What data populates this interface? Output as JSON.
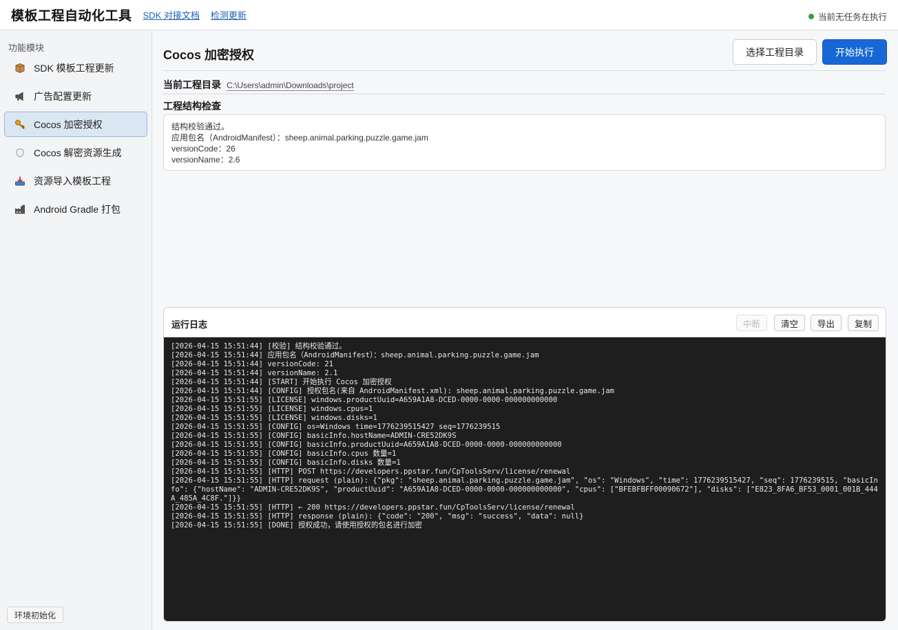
{
  "header": {
    "title": "模板工程自动化工具",
    "links": [
      "SDK 对接文档",
      "检测更新"
    ],
    "status": "当前无任务在执行",
    "status_color": "#2ea043"
  },
  "sidebar": {
    "section_title": "功能模块",
    "items": [
      {
        "label": "SDK 模板工程更新",
        "icon": "box-icon",
        "active": false
      },
      {
        "label": "广告配置更新",
        "icon": "megaphone-icon",
        "active": false
      },
      {
        "label": "Cocos 加密授权",
        "icon": "key-icon",
        "active": true
      },
      {
        "label": "Cocos 解密资源生成",
        "icon": "shield-icon",
        "active": false
      },
      {
        "label": "资源导入模板工程",
        "icon": "import-icon",
        "active": false
      },
      {
        "label": "Android Gradle 打包",
        "icon": "factory-icon",
        "active": false
      }
    ],
    "env_button": "环境初始化"
  },
  "main": {
    "title": "Cocos 加密授权",
    "select_dir_button": "选择工程目录",
    "run_button": "开始执行",
    "accent_color": "#1768d6",
    "dir_label": "当前工程目录",
    "dir_path": "C:\\Users\\admin\\Downloads\\project",
    "check_title": "工程结构检查",
    "check_lines": [
      "结构校验通过。",
      "应用包名（AndroidManifest）：sheep.animal.parking.puzzle.game.jam",
      "versionCode：26",
      "versionName：2.6"
    ]
  },
  "log": {
    "title": "运行日志",
    "buttons": {
      "interrupt": "中断",
      "clear": "清空",
      "export": "导出",
      "copy": "复制"
    },
    "lines": [
      "[2026-04-15 15:51:44] [校验] 结构校验通过。",
      "[2026-04-15 15:51:44] 应用包名（AndroidManifest）：sheep.animal.parking.puzzle.game.jam",
      "[2026-04-15 15:51:44] versionCode: 21",
      "[2026-04-15 15:51:44] versionName: 2.1",
      "[2026-04-15 15:51:44] [START] 开始执行 Cocos 加密授权",
      "[2026-04-15 15:51:44] [CONFIG] 授权包名(来自 AndroidManifest.xml): sheep.animal.parking.puzzle.game.jam",
      "[2026-04-15 15:51:55] [LICENSE] windows.productUuid=A659A1A8-DCED-0000-0000-000000000000",
      "[2026-04-15 15:51:55] [LICENSE] windows.cpus=1",
      "[2026-04-15 15:51:55] [LICENSE] windows.disks=1",
      "[2026-04-15 15:51:55] [CONFIG] os=Windows time=1776239515427 seq=1776239515",
      "[2026-04-15 15:51:55] [CONFIG] basicInfo.hostName=ADMIN-CRE52DK9S",
      "[2026-04-15 15:51:55] [CONFIG] basicInfo.productUuid=A659A1A8-DCED-0000-0000-000000000000",
      "[2026-04-15 15:51:55] [CONFIG] basicInfo.cpus 数量=1",
      "[2026-04-15 15:51:55] [CONFIG] basicInfo.disks 数量=1",
      "[2026-04-15 15:51:55] [HTTP] POST https://developers.ppstar.fun/CpToolsServ/license/renewal",
      "[2026-04-15 15:51:55] [HTTP] request (plain): {\"pkg\": \"sheep.animal.parking.puzzle.game.jam\", \"os\": \"Windows\", \"time\": 1776239515427, \"seq\": 1776239515, \"basicInfo\": {\"hostName\": \"ADMIN-CRE52DK9S\", \"productUuid\": \"A659A1A8-DCED-0000-0000-000000000000\", \"cpus\": [\"BFEBFBFF00090672\"], \"disks\": [\"E823_8FA6_BF53_0001_001B_444A_485A_4C8F.\"]}}",
      "[2026-04-15 15:51:55] [HTTP] ← 200 https://developers.ppstar.fun/CpToolsServ/license/renewal",
      "[2026-04-15 15:51:55] [HTTP] response (plain): {\"code\": \"200\", \"msg\": \"success\", \"data\": null}",
      "[2026-04-15 15:51:55] [DONE] 授权成功，请使用授权的包名进行加密"
    ]
  }
}
